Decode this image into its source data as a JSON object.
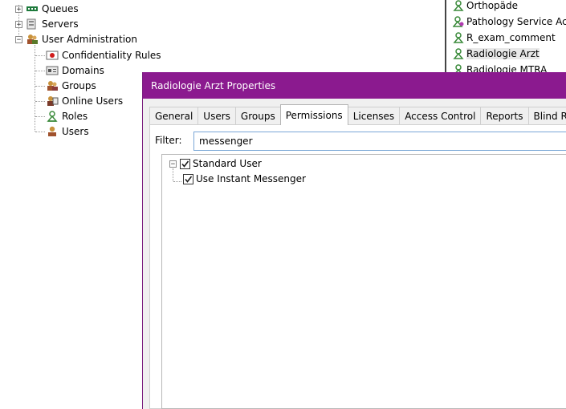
{
  "tree": {
    "queues": "Queues",
    "servers": "Servers",
    "user_admin": "User Administration",
    "children": [
      "Confidentiality Rules",
      "Domains",
      "Groups",
      "Online Users",
      "Roles",
      "Users"
    ],
    "collapse_symbol": "−",
    "expand_symbol": "+"
  },
  "roles_list": {
    "items": [
      "Orthopäde",
      "Pathology Service Acc",
      "R_exam_comment",
      "Radiologie Arzt",
      "Radiologie MTRA"
    ],
    "selected": "Radiologie Arzt"
  },
  "dialog": {
    "title": "Radiologie Arzt Properties",
    "tabs": [
      "General",
      "Users",
      "Groups",
      "Permissions",
      "Licenses",
      "Access Control",
      "Reports",
      "Blind Readi"
    ],
    "active_tab": "Permissions",
    "filter_label": "Filter:",
    "filter_value": "messenger",
    "permissions": {
      "parent": "Standard User",
      "child": "Use Instant Messenger"
    }
  },
  "colors": {
    "titlebar": "#8b1a8f",
    "role_icon": "#3a8a3a"
  }
}
